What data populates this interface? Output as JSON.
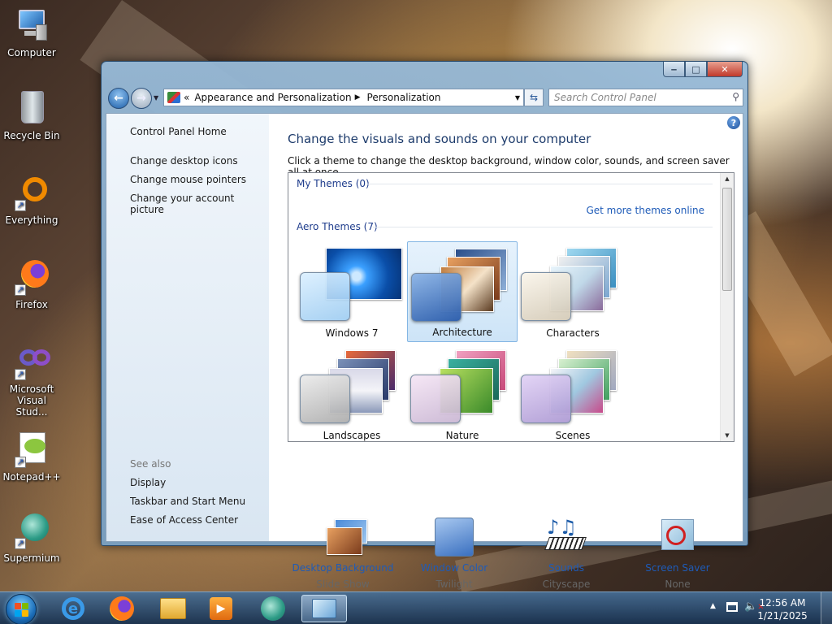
{
  "desktop": {
    "icons": [
      {
        "label": "Computer"
      },
      {
        "label": "Recycle Bin"
      },
      {
        "label": "Everything"
      },
      {
        "label": "Firefox"
      },
      {
        "label": "Microsoft Visual Stud..."
      },
      {
        "label": "Notepad++"
      },
      {
        "label": "Supermium"
      }
    ]
  },
  "window": {
    "caption_buttons": {
      "minimize": "‒",
      "maximize": "□",
      "close": "✕"
    },
    "address": {
      "prefix": "«",
      "segments": [
        "Appearance and Personalization",
        "Personalization"
      ],
      "separator": "▶"
    },
    "search": {
      "placeholder": "Search Control Panel"
    },
    "left_pane": {
      "home": "Control Panel Home",
      "links": [
        "Change desktop icons",
        "Change mouse pointers",
        "Change your account picture"
      ],
      "see_also": "See also",
      "see_also_links": [
        "Display",
        "Taskbar and Start Menu",
        "Ease of Access Center"
      ]
    },
    "main": {
      "heading": "Change the visuals and sounds on your computer",
      "subheading": "Click a theme to change the desktop background, window color, sounds, and screen saver all at once.",
      "my_themes": "My Themes (0)",
      "get_more": "Get more themes online",
      "aero_themes": "Aero Themes (7)",
      "themes": [
        {
          "name": "Windows 7",
          "selected": false
        },
        {
          "name": "Architecture",
          "selected": true
        },
        {
          "name": "Characters",
          "selected": false
        },
        {
          "name": "Landscapes",
          "selected": false
        },
        {
          "name": "Nature",
          "selected": false
        },
        {
          "name": "Scenes",
          "selected": false
        }
      ]
    },
    "bottom": [
      {
        "link": "Desktop Background",
        "value": "Slide Show"
      },
      {
        "link": "Window Color",
        "value": "Twilight"
      },
      {
        "link": "Sounds",
        "value": "Cityscape"
      },
      {
        "link": "Screen Saver",
        "value": "None"
      }
    ]
  },
  "taskbar": {
    "clock": {
      "time": "12:56 AM",
      "date": "1/21/2025"
    }
  },
  "colors": {
    "link": "#1e5bb8",
    "heading": "#1e3c6c",
    "selection": "#cde4f7"
  }
}
